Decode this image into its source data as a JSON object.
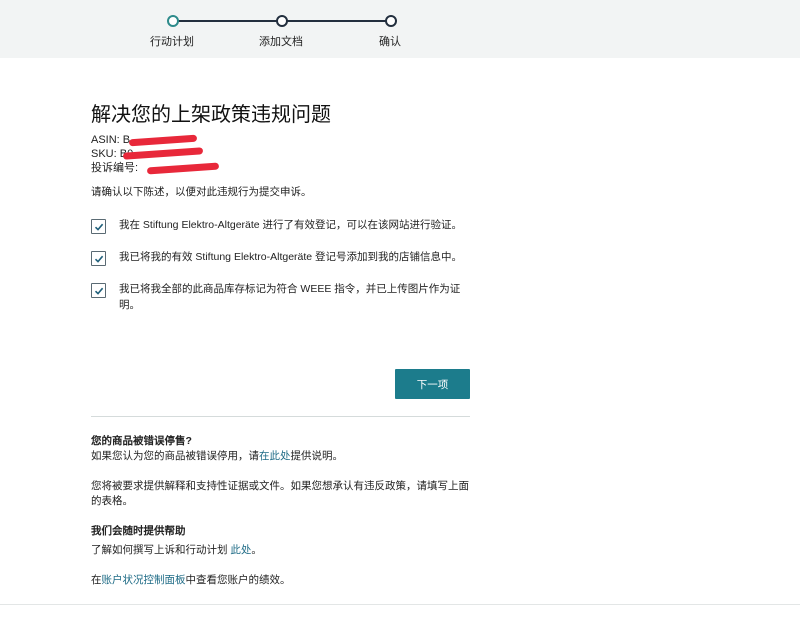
{
  "stepper": {
    "steps": [
      {
        "label": "行动计划"
      },
      {
        "label": "添加文档"
      },
      {
        "label": "确认"
      }
    ]
  },
  "main": {
    "title": "解决您的上架政策违规问题",
    "asin_label": "ASIN: B",
    "sku_label": "SKU: B0",
    "complaint_label": "投诉编号:",
    "intro": "请确认以下陈述，以便对此违规行为提交申诉。",
    "checkboxes": [
      {
        "text": "我在 Stiftung Elektro-Altgeräte 进行了有效登记，可以在该网站进行验证。",
        "checked": true
      },
      {
        "text": "我已将我的有效 Stiftung Elektro-Altgeräte 登记号添加到我的店铺信息中。",
        "checked": true
      },
      {
        "text": "我已将我全部的此商品库存标记为符合 WEEE 指令，并已上传图片作为证明。",
        "checked": true
      }
    ],
    "next_button": "下一项"
  },
  "help": {
    "wrong_title": "您的商品被错误停售?",
    "wrong_text_before": "如果您认为您的商品被错误停用，请",
    "wrong_link": "在此处",
    "wrong_text_after": "提供说明。",
    "explain_text": "您将被要求提供解释和支持性证据或文件。如果您想承认有违反政策，请填写上面的表格。",
    "support_title": "我们会随时提供帮助",
    "learn_text": "了解如何撰写上诉和行动计划 ",
    "learn_link": "此处",
    "learn_after": "。",
    "dashboard_before": "在",
    "dashboard_link": "账户状况控制面板",
    "dashboard_after": "中查看您账户的绩效。"
  },
  "colors": {
    "accent": "#1c7c8c",
    "link": "#1e6b86",
    "redaction": "#e8283a",
    "stepper_bg": "#f2f4f4"
  }
}
